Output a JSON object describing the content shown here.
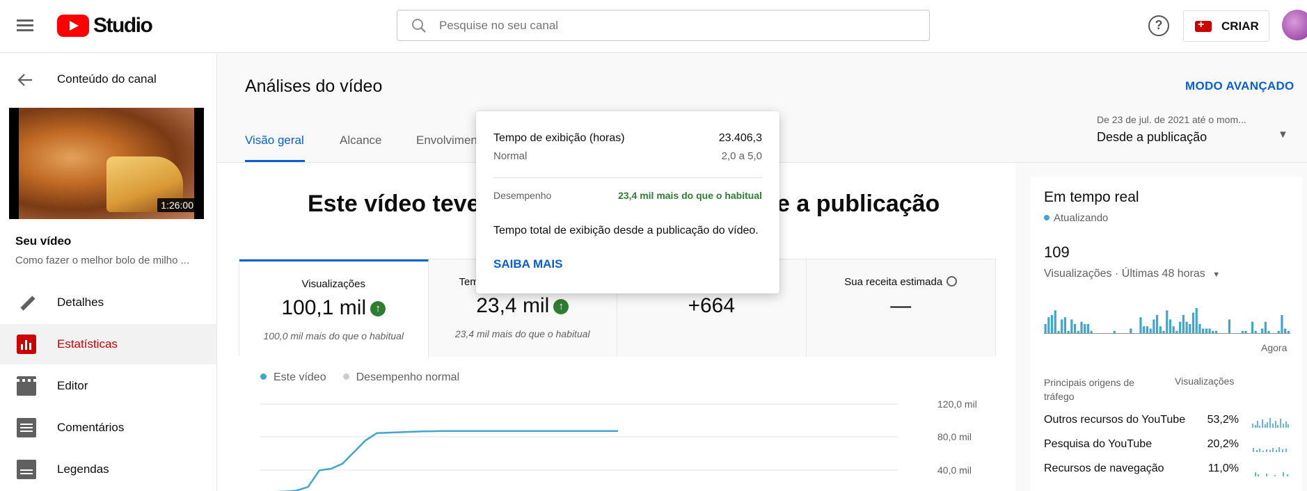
{
  "header": {
    "logo_text": "Studio",
    "search_placeholder": "Pesquise no seu canal",
    "help_glyph": "?",
    "create_label": "CRIAR"
  },
  "sidebar": {
    "back_label": "Conteúdo do canal",
    "thumbnail_duration": "1:26:00",
    "your_video_label": "Seu vídeo",
    "video_title": "Como fazer o melhor bolo de milho ...",
    "nav": [
      {
        "label": "Detalhes",
        "icon": "pencil-icon",
        "active": false
      },
      {
        "label": "Estatísticas",
        "icon": "analytics-icon",
        "active": true
      },
      {
        "label": "Editor",
        "icon": "film-icon",
        "active": false
      },
      {
        "label": "Comentários",
        "icon": "comment-icon",
        "active": false
      },
      {
        "label": "Legendas",
        "icon": "subtitles-icon",
        "active": false
      }
    ]
  },
  "main": {
    "title": "Análises do vídeo",
    "advanced_mode": "MODO AVANÇADO",
    "tabs": [
      "Visão geral",
      "Alcance",
      "Envolvimen"
    ],
    "date_range_small": "De 23 de jul. de 2021 até o mom...",
    "date_range": "Desde a publicação",
    "headline_left": "Este vídeo teve",
    "headline_right": "e a publicação",
    "cards": [
      {
        "title": "Visualizações",
        "value": "100,1 mil",
        "subtitle": "100,0 mil mais do que o habitual",
        "up": true
      },
      {
        "title": "Tem",
        "value": "23,4 mil",
        "subtitle": "23,4 mil mais do que o habitual",
        "up": true
      },
      {
        "title": "",
        "value": "+664",
        "subtitle": "",
        "up": false
      },
      {
        "title": "Sua receita estimada",
        "value": "—",
        "subtitle": "",
        "up": false
      }
    ],
    "legend": [
      {
        "label": "Este vídeo",
        "color": "#3ea6cf"
      },
      {
        "label": "Desempenho normal",
        "color": "#cccccc"
      }
    ]
  },
  "tooltip": {
    "metric_label": "Tempo de exibição (horas)",
    "metric_value": "23.406,3",
    "normal_label": "Normal",
    "normal_value": "2,0 a 5,0",
    "performance_label": "Desempenho",
    "performance_value": "23,4 mil mais do que o habitual",
    "description": "Tempo total de exibição desde a publicação do vídeo.",
    "learn_more": "SAIBA MAIS"
  },
  "realtime": {
    "title": "Em tempo real",
    "status": "Atualizando",
    "count": "109",
    "period": "Visualizações · Últimas 48 horas",
    "now_label": "Agora",
    "bars": [
      4,
      7,
      8,
      10,
      1,
      6,
      7,
      1,
      6,
      4,
      1,
      5,
      4,
      4,
      1,
      0,
      0,
      0,
      0,
      0,
      0,
      1,
      0,
      0,
      0,
      0,
      2,
      0,
      0,
      7,
      3,
      3,
      2,
      6,
      8,
      3,
      1,
      10,
      6,
      3,
      1,
      5,
      8,
      5,
      4,
      9,
      11,
      4,
      2,
      2,
      2,
      1,
      1,
      0,
      0,
      0,
      6,
      0,
      0,
      0,
      1,
      1,
      0,
      5,
      1,
      0,
      2,
      5,
      1,
      0,
      0,
      1,
      8,
      2,
      1
    ],
    "sources_header": "Principais origens de tráfego",
    "views_header": "Visualizações",
    "sources": [
      {
        "name": "Outros recursos do YouTube",
        "pct": "53,2%"
      },
      {
        "name": "Pesquisa do YouTube",
        "pct": "20,2%"
      },
      {
        "name": "Recursos de navegação",
        "pct": "11,0%"
      }
    ]
  },
  "chart_data": {
    "type": "line",
    "y_tick_labels": [
      "120,0 mil",
      "80,0 mil",
      "40,0 mil"
    ],
    "ylim": [
      0,
      120000
    ],
    "series": [
      {
        "name": "Este vídeo",
        "values": [
          0,
          11000,
          14000,
          14500,
          15500,
          20000,
          40000,
          42000,
          48000,
          62000,
          76000,
          85000,
          85500,
          86000,
          86500,
          87000,
          87300,
          87500,
          87500,
          87500,
          87500,
          87500,
          87500,
          87500,
          87500,
          87500,
          87500,
          87500,
          87500,
          87500,
          87500,
          87500,
          87500
        ]
      }
    ]
  },
  "colors": {
    "accent_blue": "#065fd4",
    "active_red": "#cc0000",
    "positive_green": "#2e7d32",
    "chart_line": "#3ea6cf"
  }
}
